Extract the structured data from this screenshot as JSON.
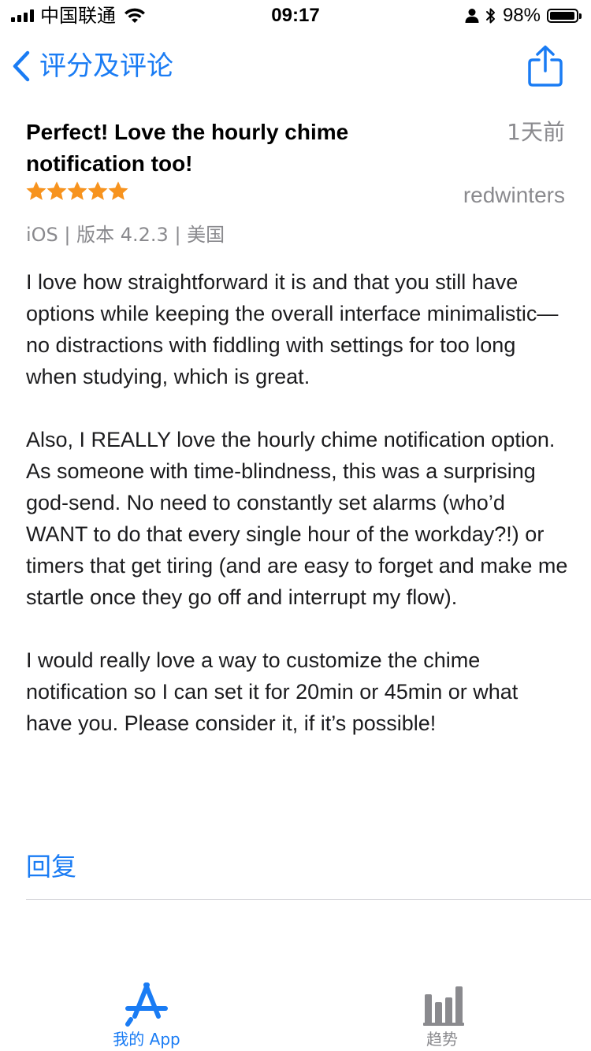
{
  "status_bar": {
    "carrier": "中国联通",
    "time": "09:17",
    "battery_percent": "98%",
    "battery_level": 0.98,
    "icons": [
      "signal-icon",
      "wifi-icon",
      "person-icon",
      "bluetooth-icon",
      "battery-icon"
    ]
  },
  "nav": {
    "back_label": "评分及评论",
    "back_icon": "chevron-left-icon",
    "share_icon": "share-icon"
  },
  "review": {
    "title": "Perfect! Love the hourly chime notification too!",
    "date": "1天前",
    "rating": 5,
    "rating_max": 5,
    "author": "redwinters",
    "meta": "iOS | 版本 4.2.3 | 美国",
    "paragraphs": [
      "I love how straightforward it is and that you still have options while keeping the overall interface minimalistic—no distractions with fiddling with settings for too long when studying, which is great.",
      "Also, I REALLY love the hourly chime notification option. As someone with time-blindness, this was a surprising god-send. No need to constantly set alarms (who’d WANT to do that every single hour of the workday?!) or timers that get tiring (and are easy to forget and make me startle once they go off and interrupt my flow).",
      "I would really love a way to customize the chime notification so I can set it for 20min or 45min or what have you. Please consider it, if it’s possible!"
    ],
    "reply_label": "回复"
  },
  "tab_bar": {
    "items": [
      {
        "label": "我的 App",
        "icon": "app-store-icon",
        "active": true
      },
      {
        "label": "趋势",
        "icon": "bar-chart-icon",
        "active": false
      }
    ]
  },
  "colors": {
    "accent": "#1a7cf4",
    "star": "#f7931e",
    "secondary_text": "#8a8a8e"
  }
}
